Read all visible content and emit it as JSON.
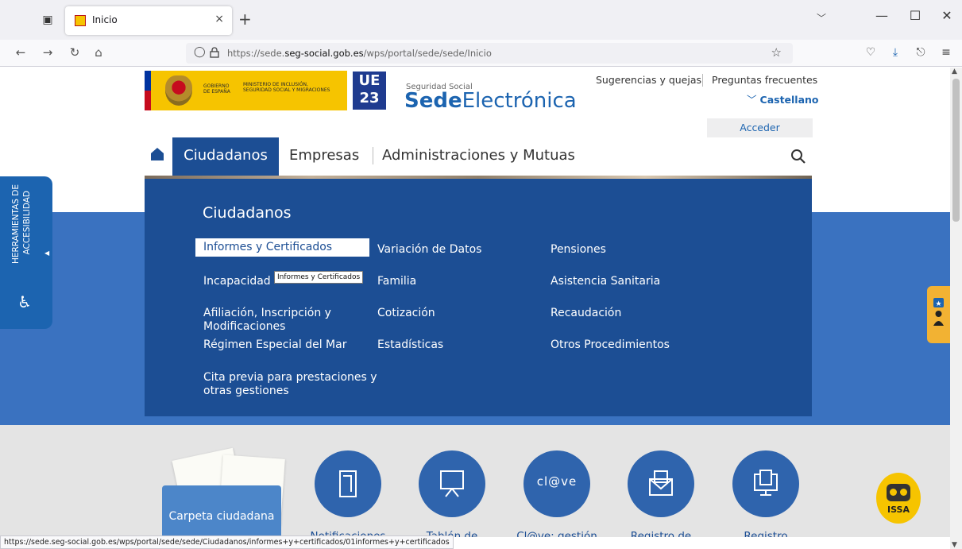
{
  "browser": {
    "tab_title": "Inicio",
    "tab_close": "×",
    "new_tab": "+",
    "url_prefix": "https://sede.",
    "url_domain": "seg-social.gob.es",
    "url_path": "/wps/portal/sede/sede/Inicio",
    "status_url": "https://sede.seg-social.gob.es/wps/portal/sede/sede/Ciudadanos/informes+y+certificados/01informes+y+certificados"
  },
  "header": {
    "gov_text1": "GOBIERNO DE ESPAÑA",
    "gov_text2": "MINISTERIO DE INCLUSIÓN, SEGURIDAD SOCIAL Y MIGRACIONES",
    "eu_top": "UE",
    "eu_bottom": "23",
    "sede_small": "Seguridad Social",
    "sede_bold": "Sede",
    "sede_light": "Electrónica",
    "sugerencias": "Sugerencias y quejas",
    "faq": "Preguntas frecuentes",
    "language": "Castellano",
    "acceder": "Acceder"
  },
  "nav": {
    "ciudadanos": "Ciudadanos",
    "empresas": "Empresas",
    "admin": "Administraciones y Mutuas"
  },
  "megamenu": {
    "title": "Ciudadanos",
    "tooltip": "Informes y Certificados",
    "col1": [
      "Informes y Certificados",
      "Incapacidad",
      "Afiliación, Inscripción y Modificaciones",
      "Régimen Especial del Mar",
      "Cita previa para prestaciones y otras gestiones"
    ],
    "col2": [
      "Variación de Datos",
      "Familia",
      "Cotización",
      "Estadísticas"
    ],
    "col3": [
      "Pensiones",
      "Asistencia Sanitaria",
      "Recaudación",
      "Otros Procedimientos"
    ]
  },
  "accessibility": {
    "line1": "HERRAMIENTAS DE",
    "line2": "ACCESIBILIDAD"
  },
  "services": {
    "carpeta": "Carpeta ciudadana",
    "clave_logo": "cl@ve",
    "labels": [
      "Notificaciones",
      "Tablón de",
      "Cl@ve: gestión",
      "Registro de",
      "Registro"
    ]
  },
  "issa": "ISSA",
  "colors": {
    "primary_blue": "#1c4e94",
    "link_blue": "#1c64b0",
    "hero_blue": "#3a72c0",
    "gov_yellow": "#f6c400",
    "helper_orange": "#f2b233"
  }
}
